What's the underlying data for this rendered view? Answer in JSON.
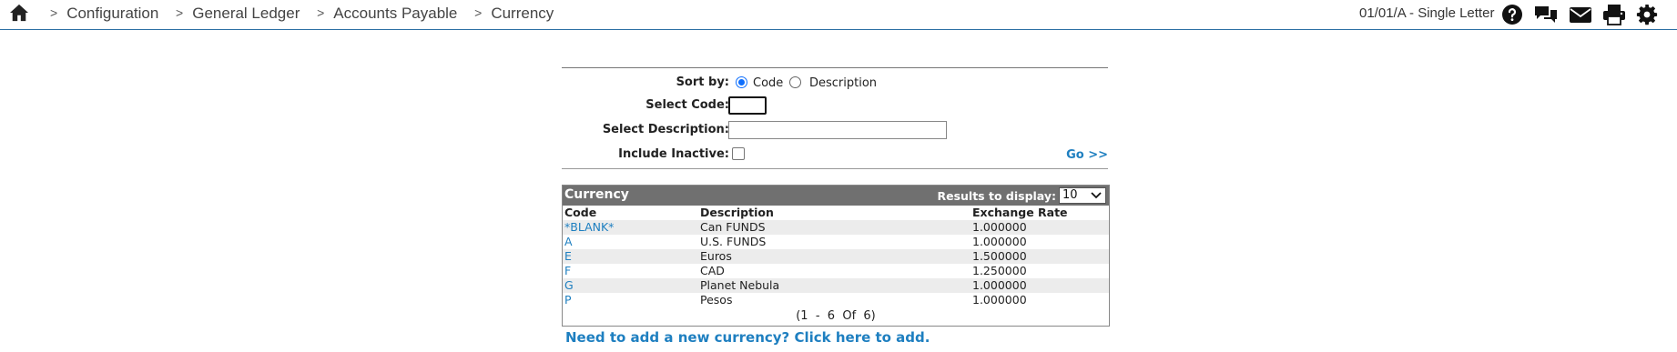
{
  "breadcrumb": {
    "items": [
      "Configuration",
      "General Ledger",
      "Accounts Payable",
      "Currency"
    ],
    "separator": ">"
  },
  "context": {
    "label": "01/01/A - Single Letter"
  },
  "toolbar": {
    "icons": [
      "help-icon",
      "chat-icon",
      "mail-icon",
      "print-icon",
      "gear-icon"
    ]
  },
  "filter": {
    "sort_label": "Sort by:",
    "sort_options": [
      "Code",
      "Description"
    ],
    "sort_selected": "Code",
    "code_label": "Select Code:",
    "code_value": "",
    "description_label": "Select Description:",
    "description_value": "",
    "inactive_label": "Include Inactive:",
    "inactive_checked": false,
    "go_label": "Go >>"
  },
  "results": {
    "title": "Currency",
    "display_label": "Results to display:",
    "display_value": "10",
    "columns": [
      "Code",
      "Description",
      "Exchange Rate"
    ],
    "rows": [
      {
        "code": "*BLANK*",
        "description": "Can FUNDS",
        "rate": "1.000000"
      },
      {
        "code": "A",
        "description": "U.S. FUNDS",
        "rate": "1.000000"
      },
      {
        "code": "E",
        "description": "Euros",
        "rate": "1.500000"
      },
      {
        "code": "F",
        "description": "CAD",
        "rate": "1.250000"
      },
      {
        "code": "G",
        "description": "Planet Nebula",
        "rate": "1.000000"
      },
      {
        "code": "P",
        "description": "Pesos",
        "rate": "1.000000"
      }
    ],
    "pager": "(1  -  6  Of  6)"
  },
  "add_link": "Need to add a new currency? Click here to add.",
  "colors": {
    "accent": "#1e7fc0",
    "header_bar": "#707070",
    "topbar_border": "#2b6ea3"
  }
}
